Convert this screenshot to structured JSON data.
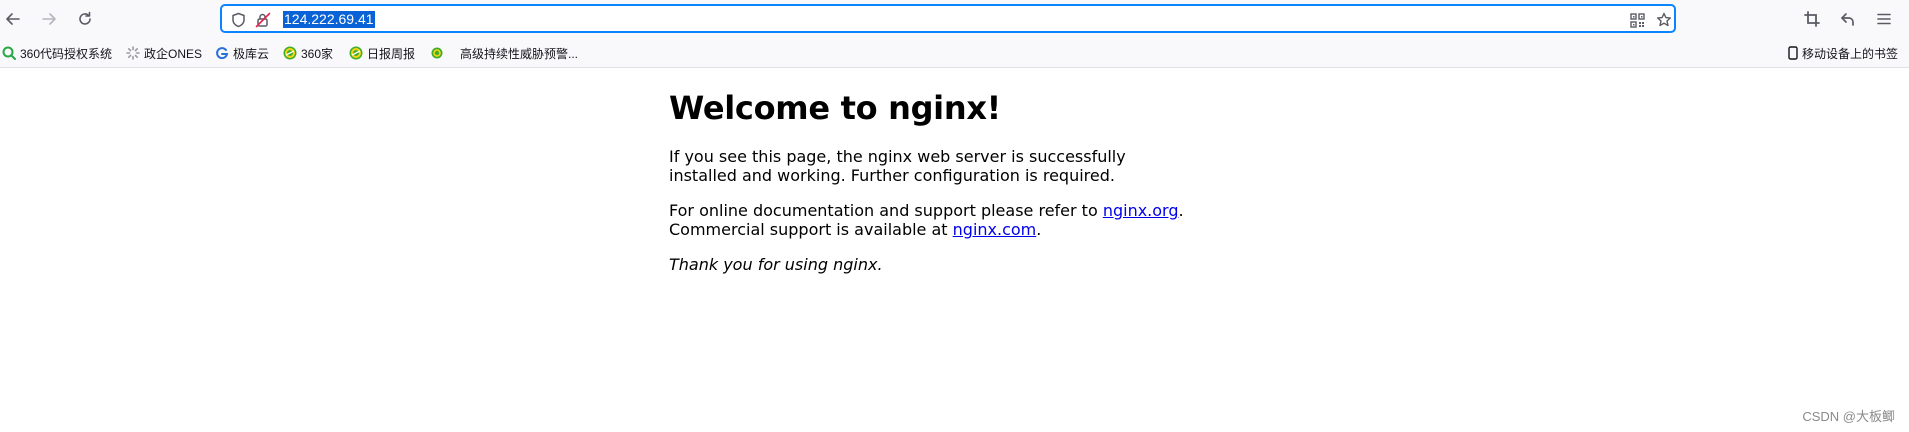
{
  "browser": {
    "url": "124.222.69.41",
    "colors": {
      "accent": "#0a84ff",
      "selection": "#0a63d6",
      "toolbar": "#f9f9fb"
    },
    "nav_icons": [
      "back-arrow-icon",
      "forward-arrow-icon",
      "reload-icon"
    ],
    "url_icons": [
      "shield-icon",
      "insecure-lock-icon",
      "qr-code-icon",
      "bookmark-star-icon"
    ],
    "right_icons": [
      "crop-icon",
      "undo-icon",
      "menu-icon"
    ]
  },
  "bookmarks": {
    "items": [
      {
        "label": "360代码授权系统",
        "icon": "search-circle-icon"
      },
      {
        "label": "政企ONES",
        "icon": "spinner-icon"
      },
      {
        "label": "极库云",
        "icon": "cloud-g-icon"
      },
      {
        "label": "360家",
        "icon": "360-logo-icon"
      },
      {
        "label": "日报周报",
        "icon": "360-logo-icon"
      },
      {
        "label": "高级持续性威胁预警...",
        "icon": "360-small-icon"
      }
    ],
    "mobile_label": "移动设备上的书签"
  },
  "page": {
    "title": "Welcome to nginx!",
    "para1": "If you see this page, the nginx web server is successfully installed and working. Further configuration is required.",
    "para2_pre": "For online documentation and support please refer to ",
    "link1": "nginx.org",
    "para2_mid1": ".",
    "para2_mid2": "Commercial support is available at ",
    "link2": "nginx.com",
    "para2_end": ".",
    "thanks": "Thank you for using nginx."
  },
  "watermark": "CSDN @大板鲫"
}
